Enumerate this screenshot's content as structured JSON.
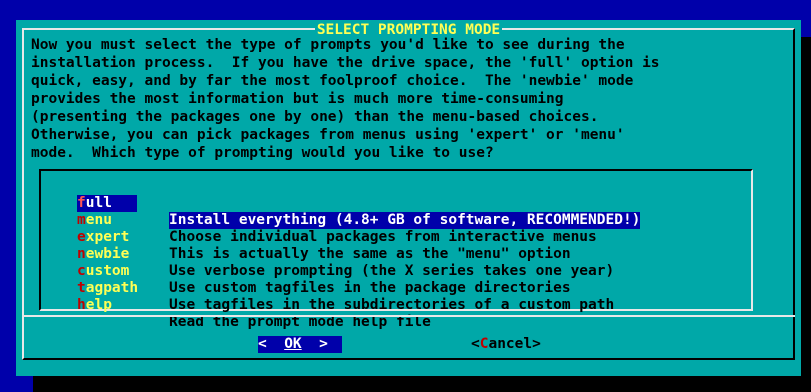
{
  "dialog": {
    "title": "SELECT PROMPTING MODE",
    "prompt": "Now you must select the type of prompts you'd like to see during the\ninstallation process.  If you have the drive space, the 'full' option is\nquick, easy, and by far the most foolproof choice.  The 'newbie' mode\nprovides the most information but is much more time-consuming\n(presenting the packages one by one) than the menu-based choices.\nOtherwise, you can pick packages from menus using 'expert' or 'menu'\nmode.  Which type of prompting would you like to use?"
  },
  "menu": {
    "items": [
      {
        "tag_first": "f",
        "tag_rest": "ull",
        "desc": "Install everything (4.8+ GB of software, RECOMMENDED!)",
        "selected": true
      },
      {
        "tag_first": "m",
        "tag_rest": "enu",
        "desc": "Choose individual packages from interactive menus",
        "selected": false
      },
      {
        "tag_first": "e",
        "tag_rest": "xpert",
        "desc": "This is actually the same as the \"menu\" option",
        "selected": false
      },
      {
        "tag_first": "n",
        "tag_rest": "ewbie",
        "desc": "Use verbose prompting (the X series takes one year)",
        "selected": false
      },
      {
        "tag_first": "c",
        "tag_rest": "ustom",
        "desc": "Use custom tagfiles in the package directories",
        "selected": false
      },
      {
        "tag_first": "t",
        "tag_rest": "agpath",
        "desc": "Use tagfiles in the subdirectories of a custom path",
        "selected": false
      },
      {
        "tag_first": "h",
        "tag_rest": "elp",
        "desc": "Read the prompt mode help file",
        "selected": false
      }
    ]
  },
  "buttons": {
    "ok": {
      "left": "<  ",
      "hot": "OK",
      "right": "  >"
    },
    "cancel": {
      "left": "<",
      "hot": "C",
      "rest": "ancel",
      "right": ">"
    }
  },
  "colors": {
    "background": "#0000aa",
    "dialog": "#00a8a8",
    "title": "#ffff54",
    "tag": "#ffff54",
    "hotkey": "#c00000",
    "selection": "#0000aa"
  }
}
